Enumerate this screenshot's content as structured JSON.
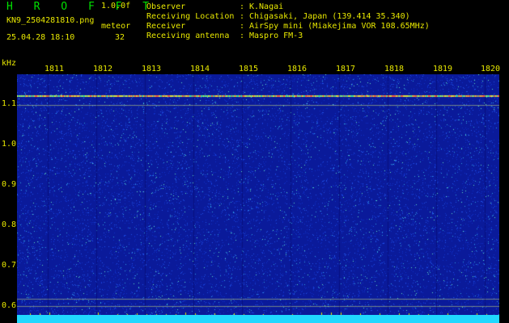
{
  "header": {
    "app_title": "H R O F F T",
    "version": "1.0.0f",
    "file_name": "KN9_2504281810.png",
    "timestamp": "25.04.28 18:10",
    "mode": "meteor",
    "count": "32"
  },
  "station": [
    {
      "label": "Observer",
      "value": "K.Nagai"
    },
    {
      "label": "Receiving Location",
      "value": "Chigasaki, Japan (139.414 35.340)"
    },
    {
      "label": "Receiver",
      "value": "AirSpy mini (Miakejima VOR 108.65MHz)"
    },
    {
      "label": "Receiving antenna",
      "value": "Maspro FM-3"
    }
  ],
  "axes": {
    "y_unit": "kHz",
    "x_ticks": [
      "1811",
      "1812",
      "1813",
      "1814",
      "1815",
      "1816",
      "1817",
      "1818",
      "1819",
      "1820"
    ],
    "y_ticks": [
      "1.1",
      "1.0",
      "0.9",
      "0.8",
      "0.7",
      "0.6"
    ]
  },
  "colors": {
    "text": "#e8e800",
    "title": "#00e000",
    "background": "#0a1a9a",
    "baseline": "#20d8ff"
  }
}
